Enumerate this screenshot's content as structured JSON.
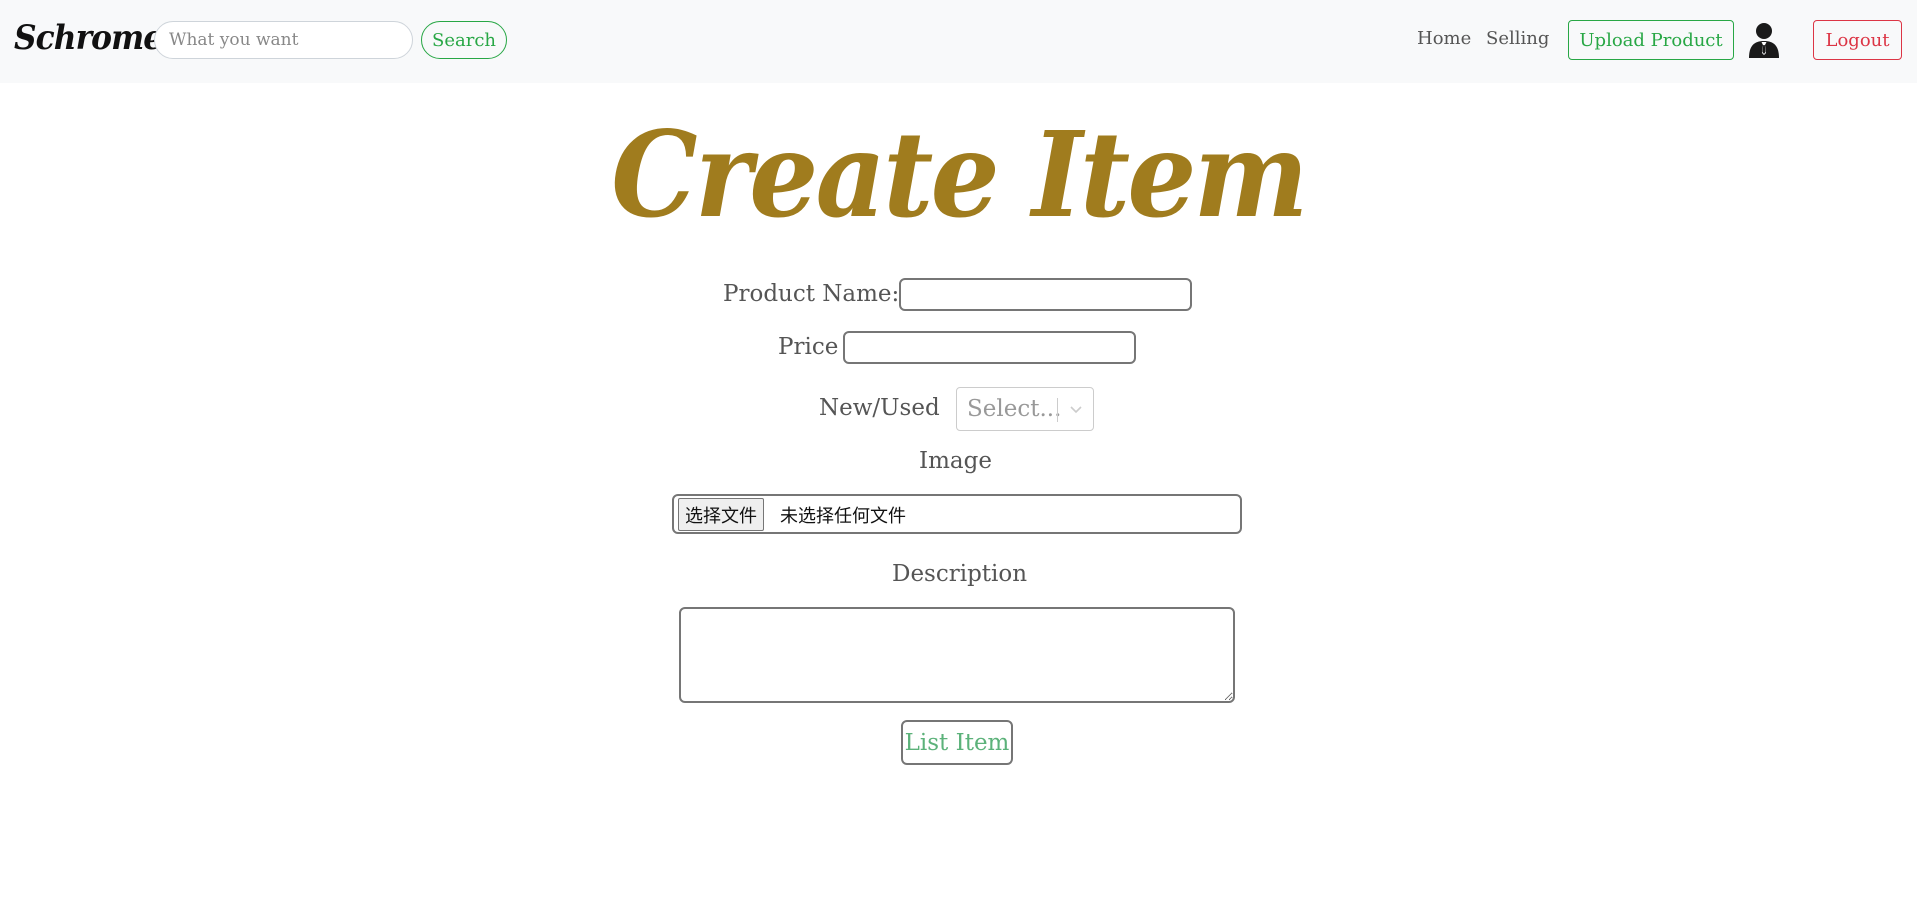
{
  "navbar": {
    "brand": "Schromeo",
    "search": {
      "placeholder": "What you want",
      "value": ""
    },
    "search_label": "Search",
    "links": {
      "home": "Home",
      "selling": "Selling"
    },
    "upload_label": "Upload Product",
    "user_icon": "user-icon",
    "logout_label": "Logout"
  },
  "form": {
    "title": "Create Item",
    "product_name_label": "Product Name:",
    "price_label": "Price",
    "condition_label": "New/Used",
    "condition_placeholder": "Select...",
    "image_label": "Image",
    "file_button_label": "选择文件",
    "file_status": "未选择任何文件",
    "description_label": "Description",
    "submit_label": "List Item"
  },
  "colors": {
    "title": "#a07c1e",
    "success": "#28a745",
    "danger": "#dc3545",
    "navbar_bg": "#f8f9fa"
  }
}
